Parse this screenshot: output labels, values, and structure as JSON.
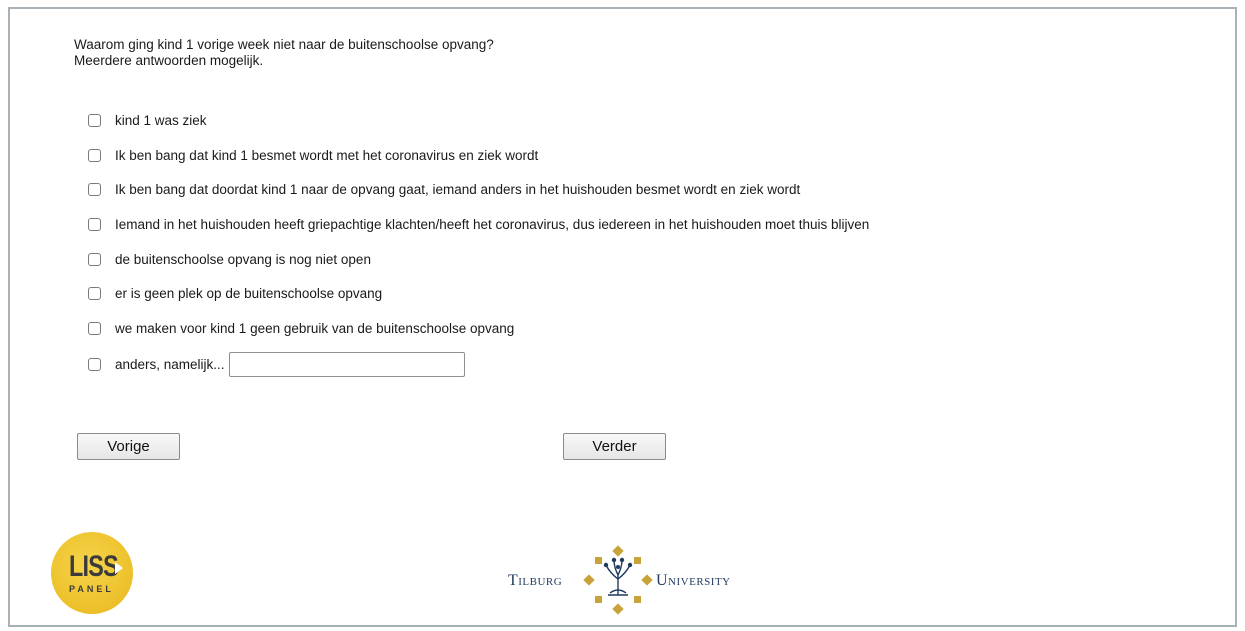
{
  "question": {
    "text": "Waarom ging kind 1 vorige week niet naar de buitenschoolse opvang?",
    "hint": "Meerdere antwoorden mogelijk."
  },
  "options": [
    {
      "label": "kind 1 was ziek",
      "checked": false
    },
    {
      "label": "Ik ben bang dat kind 1 besmet wordt met het coronavirus en ziek wordt",
      "checked": false
    },
    {
      "label": "Ik ben bang dat doordat kind 1 naar de opvang gaat, iemand anders in het huishouden besmet wordt en ziek wordt",
      "checked": false
    },
    {
      "label": "Iemand in het huishouden heeft griepachtige klachten/heeft het coronavirus, dus iedereen in het huishouden moet thuis blijven",
      "checked": false
    },
    {
      "label": "de buitenschoolse opvang is nog niet open",
      "checked": false
    },
    {
      "label": "er is geen plek op de buitenschoolse opvang",
      "checked": false
    },
    {
      "label": "we maken voor kind 1 geen gebruik van de buitenschoolse opvang",
      "checked": false
    },
    {
      "label": "anders, namelijk...",
      "checked": false,
      "input_value": ""
    }
  ],
  "buttons": {
    "prev": "Vorige",
    "next": "Verder"
  },
  "logos": {
    "liss_main": "LISS",
    "liss_sub": "PANEL",
    "tilburg_left": "Tilburg",
    "tilburg_right": "University"
  },
  "colors": {
    "liss_yellow": "#e7b71c",
    "tilburg_blue": "#1f3a5f",
    "tilburg_gold": "#c9a23a"
  }
}
